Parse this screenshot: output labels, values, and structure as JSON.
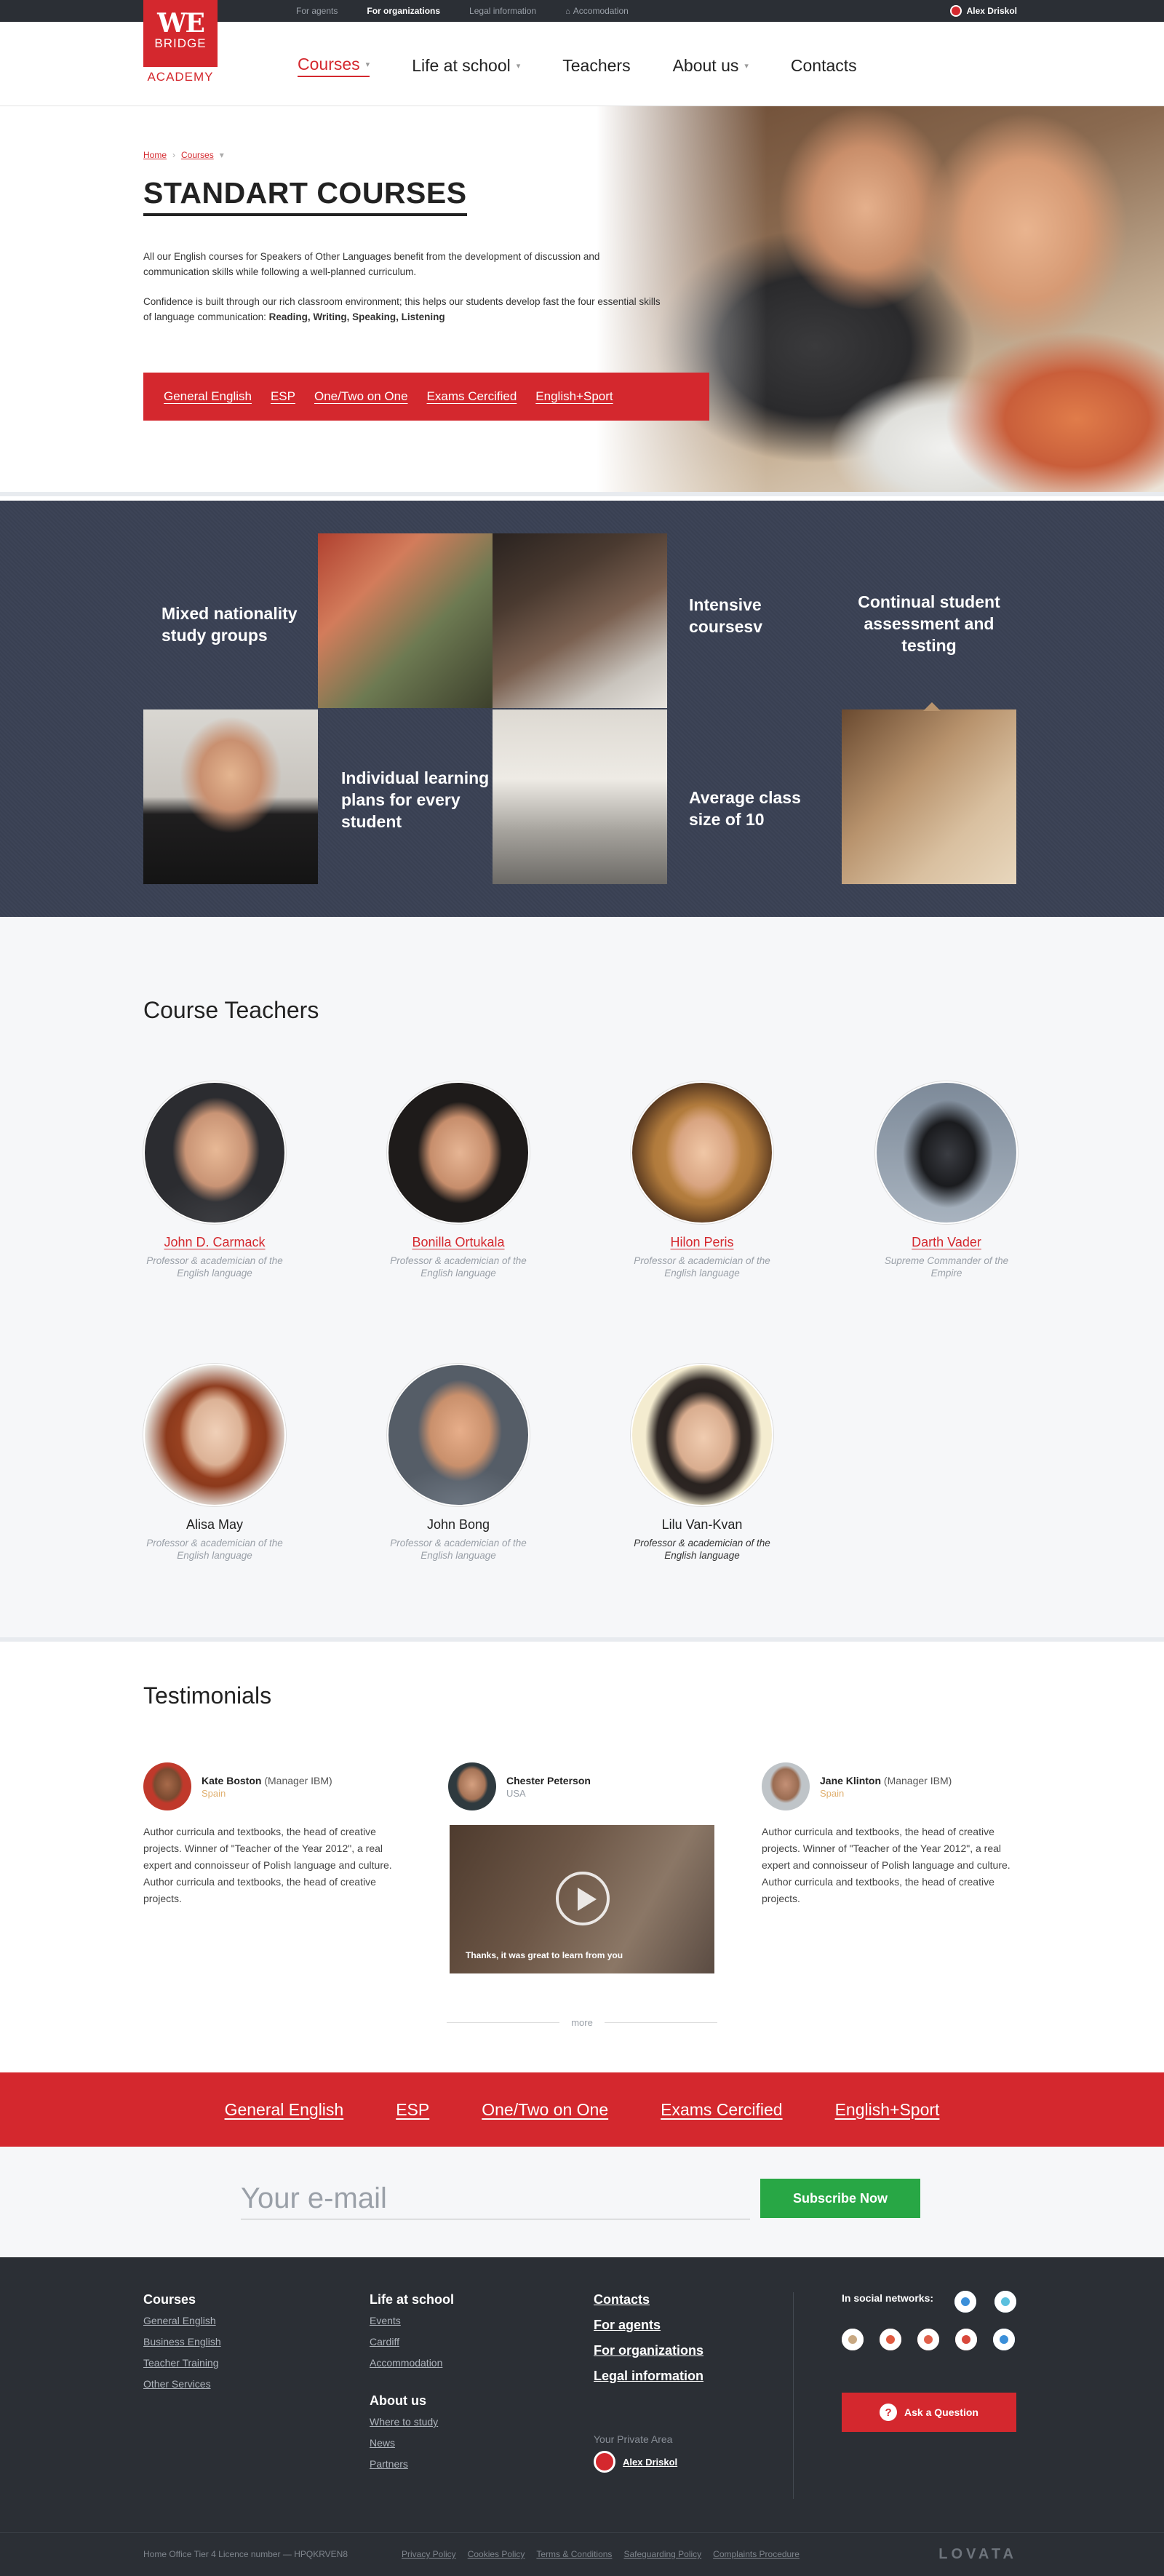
{
  "topbar": {
    "links": [
      "For agents",
      "For organizations",
      "Legal information",
      "Accomodation"
    ],
    "active_index": 1,
    "user": "Alex Driskol"
  },
  "logo": {
    "we": "WE",
    "bridge": "BRIDGE",
    "academy": "ACADEMY"
  },
  "nav": {
    "items": [
      {
        "label": "Courses",
        "has_dropdown": true,
        "active": true
      },
      {
        "label": "Life at school",
        "has_dropdown": true,
        "active": false
      },
      {
        "label": "Teachers",
        "has_dropdown": false,
        "active": false
      },
      {
        "label": "About us",
        "has_dropdown": true,
        "active": false
      },
      {
        "label": "Contacts",
        "has_dropdown": false,
        "active": false
      }
    ]
  },
  "hero": {
    "breadcrumb": {
      "home": "Home",
      "current": "Courses"
    },
    "title": "STANDART COURSES",
    "p1": "All our English courses for Speakers of Other Languages benefit from the development of discussion and communication skills while following a well-planned curriculum.",
    "p2_prefix": "Confidence is built through our rich classroom environment; this helps our students develop fast the four essential skills of language communication: ",
    "p2_bold": "Reading, Writing, Speaking, Listening",
    "course_links": [
      "General English",
      "ESP",
      "One/Two on One",
      "Exams Cercified",
      "English+Sport"
    ]
  },
  "features": {
    "mixed": "Mixed nationality study groups",
    "intensive": "Intensive coursesv",
    "continual": "Continual student assessment and testing",
    "individual": "Individual learning plans for every student",
    "average": "Average class size of 10"
  },
  "teachers": {
    "heading": "Course Teachers",
    "list": [
      {
        "name": "John D. Carmack",
        "role": "Professor & academician of the English language"
      },
      {
        "name": "Bonilla Ortukala",
        "role": "Professor & academician of the English language"
      },
      {
        "name": "Hilon Peris",
        "role": "Professor & academician of the English language"
      },
      {
        "name": "Darth Vader",
        "role": "Supreme Commander of the Empire"
      },
      {
        "name": "Alisa May",
        "role": "Professor & academician of the English language"
      },
      {
        "name": "John Bong",
        "role": "Professor & academician of the English language"
      },
      {
        "name": "Lilu Van-Kvan",
        "role": "Professor & academician of the English language"
      }
    ]
  },
  "testimonials": {
    "heading": "Testimonials",
    "items": [
      {
        "name": "Kate Boston",
        "role": "(Manager IBM)",
        "location": "Spain",
        "text": "Author curricula and textbooks, the head of creative projects. Winner of \"Teacher of the Year 2012\", a real expert and connoisseur of Polish language and culture. Author curricula and textbooks, the head of creative projects."
      },
      {
        "name": "Chester Peterson",
        "role": "",
        "location": "USA",
        "video_caption": "Thanks, it was great to learn from you"
      },
      {
        "name": "Jane Klinton",
        "role": "(Manager IBM)",
        "location": "Spain",
        "text": "Author curricula and textbooks, the head of creative projects. Winner of \"Teacher of the Year 2012\", a real expert and connoisseur of Polish language and culture. Author curricula and textbooks, the head of creative projects."
      }
    ],
    "more": "more"
  },
  "red_band": {
    "links": [
      "General English",
      "ESP",
      "One/Two on One",
      "Exams Cercified",
      "English+Sport"
    ]
  },
  "subscribe": {
    "placeholder": "Your e-mail",
    "button": "Subscribe Now"
  },
  "footer": {
    "courses": {
      "heading": "Courses",
      "links": [
        "General English",
        "Business English",
        "Teacher Training",
        "Other Services"
      ]
    },
    "life": {
      "heading": "Life at school",
      "links": [
        "Events",
        "Cardiff",
        "Accommodation"
      ]
    },
    "about": {
      "heading": "About us",
      "links": [
        "Where to study",
        "News",
        "Partners"
      ]
    },
    "contacts": {
      "links": [
        "Contacts",
        "For agents",
        "For organizations",
        "Legal information"
      ]
    },
    "private_area": {
      "label": "Your Private Area",
      "user": "Alex Driskol"
    },
    "social": {
      "label": "In social networks:",
      "colors": [
        "#3b8fd9",
        "#5bc0de",
        "#c8a882",
        "#e05a40",
        "#e0604a",
        "#d9483b",
        "#3b8fd9"
      ]
    },
    "ask": "Ask a Question"
  },
  "bottom": {
    "licence": "Home Office Tier 4 Licence number — HPQKRVEN8",
    "policies": [
      "Privacy Policy",
      "Cookies Policy",
      "Terms & Conditions",
      "Safeguarding Policy",
      "Complaints Procedure"
    ],
    "brand": "LOVATA"
  },
  "colors": {
    "accent": "#d4282e",
    "dark": "#2b2f35",
    "feature_bg": "#3a4154",
    "green": "#28a745"
  }
}
